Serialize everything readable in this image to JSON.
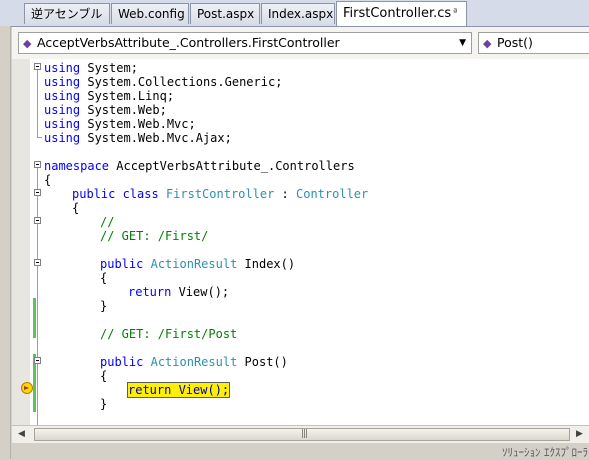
{
  "tabs": [
    {
      "label": "逆アセンブル"
    },
    {
      "label": "Web.config"
    },
    {
      "label": "Post.aspx"
    },
    {
      "label": "Index.aspx"
    },
    {
      "label": "FirstController.cs",
      "active": true,
      "pin": "ª"
    }
  ],
  "navbar": {
    "type_selector": "AcceptVerbsAttribute_.Controllers.FirstController",
    "member_selector": "Post()"
  },
  "code": {
    "l1_kw": "using",
    "l1_tx": " System;",
    "l2_kw": "using",
    "l2_tx": " System.Collections.Generic;",
    "l3_kw": "using",
    "l3_tx": " System.Linq;",
    "l4_kw": "using",
    "l4_tx": " System.Web;",
    "l5_kw": "using",
    "l5_tx": " System.Web.Mvc;",
    "l6_kw": "using",
    "l6_tx": " System.Web.Mvc.Ajax;",
    "ns_kw": "namespace",
    "ns_tx": " AcceptVerbsAttribute_.Controllers",
    "brace_open": "{",
    "brace_close": "}",
    "class_kw": "public class",
    "class_name": "FirstController",
    "class_sep": " : ",
    "class_base": "Controller",
    "comment_blank": "//",
    "comment_index": "// GET: /First/",
    "public_kw": "public",
    "action_type": "ActionResult",
    "index_sig": " Index()",
    "return_kw": "return",
    "return_tx": " View();",
    "comment_post": "// GET: /First/Post",
    "post_sig": " Post()",
    "current_stmt": "return View();"
  },
  "bottom": {
    "status": "ｿﾘｭｰｼｮﾝ ｴｸｽﾌﾟﾛｰﾗ"
  },
  "colors": {
    "keyword": "#0000ff",
    "type": "#2b91af",
    "comment": "#008000",
    "current_statement": "#ffef00"
  }
}
